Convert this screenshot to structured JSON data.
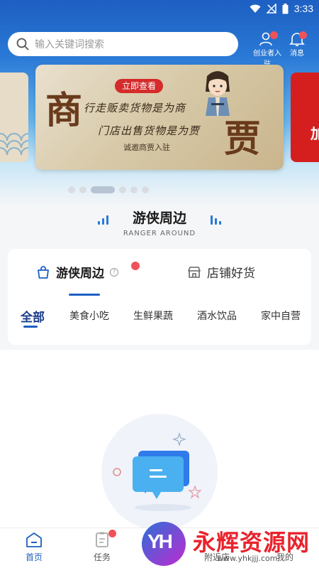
{
  "status_bar": {
    "time": "3:33"
  },
  "search": {
    "placeholder": "输入关键词搜索"
  },
  "header": {
    "entrepreneur_label": "创业者入驻",
    "message_label": "消息"
  },
  "banner": {
    "cta": "立即查看",
    "big_char_1": "商",
    "big_char_2": "贾",
    "line_1": "行走贩卖货物是为商",
    "line_2": "门店出售货物是为贾",
    "sub": "诚邀商贾入驻",
    "right_slide_text": "加"
  },
  "carousel": {
    "count": 6,
    "active": 2
  },
  "section": {
    "title": "游侠周边",
    "subtitle": "RANGER AROUND"
  },
  "tabs": [
    {
      "label": "游侠周边",
      "icon": "shopping-bag-icon",
      "active": true
    },
    {
      "label": "店铺好货",
      "icon": "store-icon",
      "active": false
    }
  ],
  "categories": [
    "全部",
    "美食小吃",
    "生鲜果蔬",
    "酒水饮品",
    "家中自营"
  ],
  "nav": [
    {
      "label": "首页",
      "icon": "home-icon",
      "active": true
    },
    {
      "label": "任务",
      "icon": "task-icon",
      "active": false
    },
    {
      "label": "附近店",
      "icon": "nearby-icon",
      "active": false
    },
    {
      "label": "我的",
      "icon": "profile-icon",
      "active": false
    }
  ],
  "watermark": {
    "logo": "YH",
    "title": "永辉资源网",
    "url": "www.yhkjjj.com"
  },
  "colors": {
    "primary": "#1d5fc2",
    "badge": "#f0525a",
    "cta": "#d42b2b"
  }
}
